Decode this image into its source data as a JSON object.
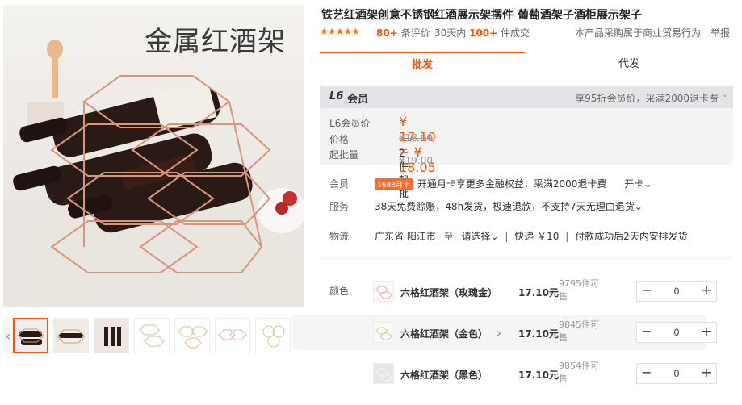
{
  "gallery": {
    "caption": "金属红酒架",
    "thumb_prev": "‹",
    "thumb_next": "›"
  },
  "product": {
    "title": "铁艺红酒架创意不锈钢红酒展示架摆件 葡萄酒架子酒柜展示架子",
    "stars": "★★★★★",
    "eval_count": "80+",
    "eval_label": "条评价",
    "sep": "|",
    "sold_prefix": "30天内",
    "sold_count": "100+",
    "sold_suffix": "件成交",
    "note": "本产品采购属于商业贸易行为",
    "report": "举报"
  },
  "tabs": [
    {
      "label": "批发",
      "active": true
    },
    {
      "label": "代发",
      "active": false
    }
  ],
  "member": {
    "level": "L6",
    "level_text": "会员",
    "discount": "享95折会员价，采满2000退卡费",
    "caret": "⌄",
    "member_price_label": "L6会员价",
    "member_price": "¥ 17.10 ~ ¥ 18.05",
    "price_label": "价格",
    "price": "¥18.00 ~ ¥19.00",
    "moq_label": "起批量",
    "moq": "2件起批"
  },
  "info": {
    "member_label": "会员",
    "card_badge": "1688月卡",
    "card_text": "开通月卡享更多金融权益，采满2000退卡费",
    "card_action": "开卡⌄",
    "service_label": "服务",
    "service_text": "38天免费赊账，48h发货，极速退款，不支持7天无理由退货⌄",
    "logistics_label": "物流",
    "logistics_from": "广东省 阳江市",
    "logistics_to_word": "至",
    "logistics_to": "请选择⌄",
    "logistics_sep": "|",
    "logistics_express": "快递 ￥10",
    "logistics_ship": "付款成功后2天内安排发货"
  },
  "sku": {
    "label": "颜色",
    "items": [
      {
        "name": "六格红酒架（玫瑰金）",
        "price": "17.10元",
        "stock": "9795件可售",
        "qty": "0"
      },
      {
        "name": "六格红酒架（金色）",
        "price": "17.10元",
        "stock": "9845件可售",
        "qty": "0"
      },
      {
        "name": "六格红酒架（黑色）",
        "price": "17.10元",
        "stock": "9854件可售",
        "qty": "0"
      }
    ],
    "minus": "−",
    "plus": "+"
  },
  "colors": {
    "accent": "#ff5000",
    "rack": "#d9967c"
  }
}
